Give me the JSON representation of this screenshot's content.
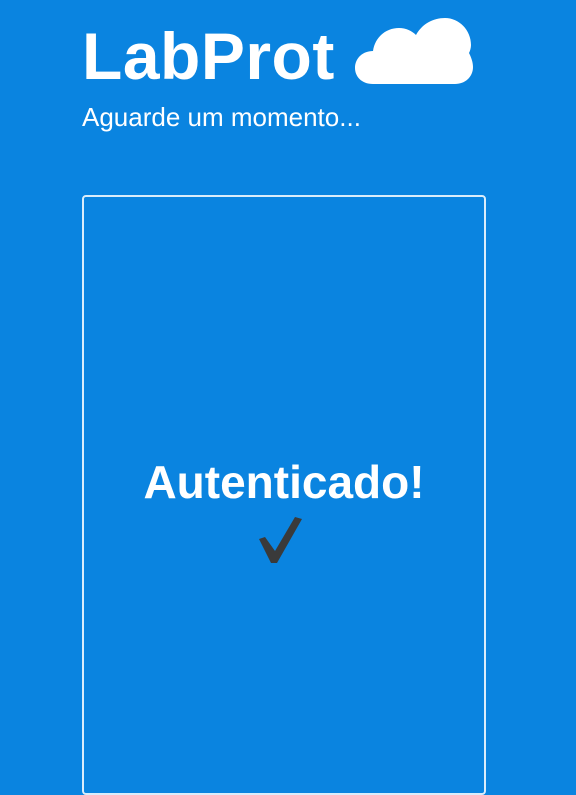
{
  "app": {
    "title": "LabProt",
    "subtitle": "Aguarde um momento..."
  },
  "icons": {
    "logo": "cloud-icon",
    "status": "checkmark-icon"
  },
  "auth_panel": {
    "status_text": "Autenticado!"
  },
  "colors": {
    "background": "#0a84e0",
    "text": "#ffffff",
    "checkmark": "#3a3a3a"
  }
}
